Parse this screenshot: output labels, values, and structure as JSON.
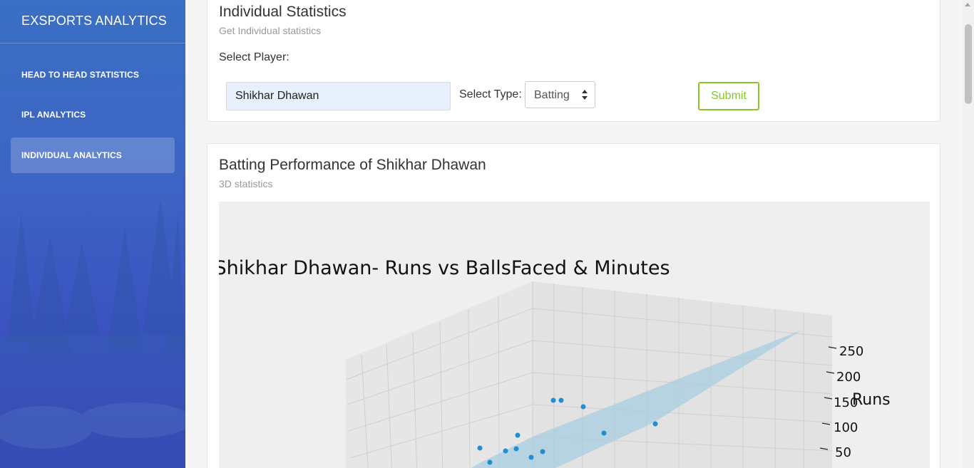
{
  "sidebar": {
    "brand": "EXSPORTS ANALYTICS",
    "items": [
      {
        "label": "HEAD TO HEAD STATISTICS",
        "active": false
      },
      {
        "label": "IPL ANALYTICS",
        "active": false
      },
      {
        "label": "INDIVIDUAL ANALYTICS",
        "active": true
      }
    ]
  },
  "form_card": {
    "title": "Individual Statistics",
    "subtitle": "Get Individual statistics",
    "player_label": "Select Player:",
    "player_value": "Shikhar Dhawan",
    "type_label": "Select Type:",
    "type_value": "Batting",
    "submit_label": "Submit"
  },
  "chart_card": {
    "title": "Batting Performance of Shikhar Dhawan",
    "subtitle": "3D statistics"
  },
  "chart_data": {
    "type": "scatter",
    "title": "Shikhar Dhawan- Runs vs BallsFaced & Minutes",
    "zlabel": "Runs",
    "z_ticks": [
      "250",
      "200",
      "150",
      "100",
      "50"
    ],
    "point_color": "#1f8fd0",
    "plane_color": "#a8cde0"
  },
  "colors": {
    "accent_green": "#87c52b"
  }
}
